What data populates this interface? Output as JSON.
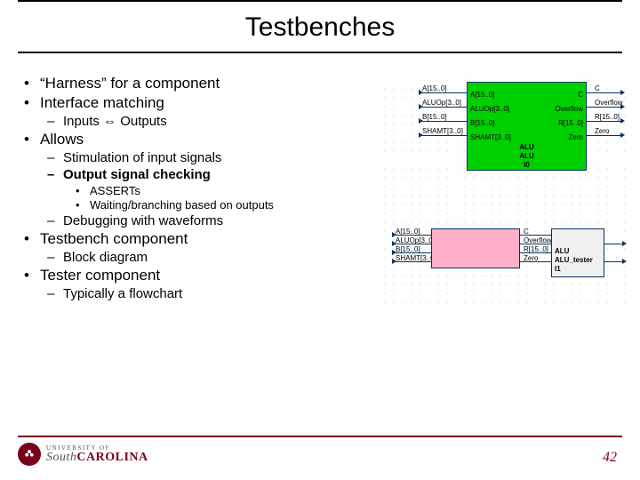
{
  "title": "Testbenches",
  "bullets": {
    "b1": "“Harness” for a component",
    "b2": "Interface matching",
    "b2_1": "Inputs ⇔ Outputs",
    "b3": "Allows",
    "b3_1": "Stimulation of input signals",
    "b3_2": "Output signal checking",
    "b3_2_1": "ASSERTs",
    "b3_2_2": "Waiting/branching based on outputs",
    "b3_3": "Debugging with waveforms",
    "b4": "Testbench component",
    "b4_1": "Block diagram",
    "b5": "Tester component",
    "b5_1": "Typically a flowchart"
  },
  "diagram": {
    "green": {
      "center1": "ALU",
      "center2": "ALU",
      "center3": "I0",
      "port_left_1": "A[15..0]",
      "port_left_2": "ALUOp[3..0]",
      "port_left_3": "B[15..0]",
      "port_left_4": "SHAMT[3..0]",
      "port_right_1": "C",
      "port_right_2": "Overflow",
      "port_right_3": "R[15..0]",
      "port_right_4": "Zero",
      "ext_left_1": "A[15..0]",
      "ext_left_2": "ALUOp[3..0]",
      "ext_left_3": "B[15..0]",
      "ext_left_4": "SHAMT[3..0]",
      "ext_right_1": "C",
      "ext_right_2": "Overflow",
      "ext_right_3": "R[15..0]",
      "ext_right_4": "Zero"
    },
    "pink": {
      "ext_left_1": "A[15..0]",
      "ext_left_2": "ALUOp[3..0]",
      "ext_left_3": "B[15..0]",
      "ext_left_4": "SHAMT[3..0]",
      "ext_right_1": "C",
      "ext_right_2": "Overflow",
      "ext_right_3": "R[15..0]",
      "ext_right_4": "Zero"
    },
    "grey": {
      "l1": "ALU",
      "l2": "ALU_tester",
      "l3": "I1"
    }
  },
  "footer": {
    "univ_top": "UNIVERSITY OF",
    "univ_south": "South",
    "univ_carolina": "CAROLINA",
    "page": "42"
  }
}
